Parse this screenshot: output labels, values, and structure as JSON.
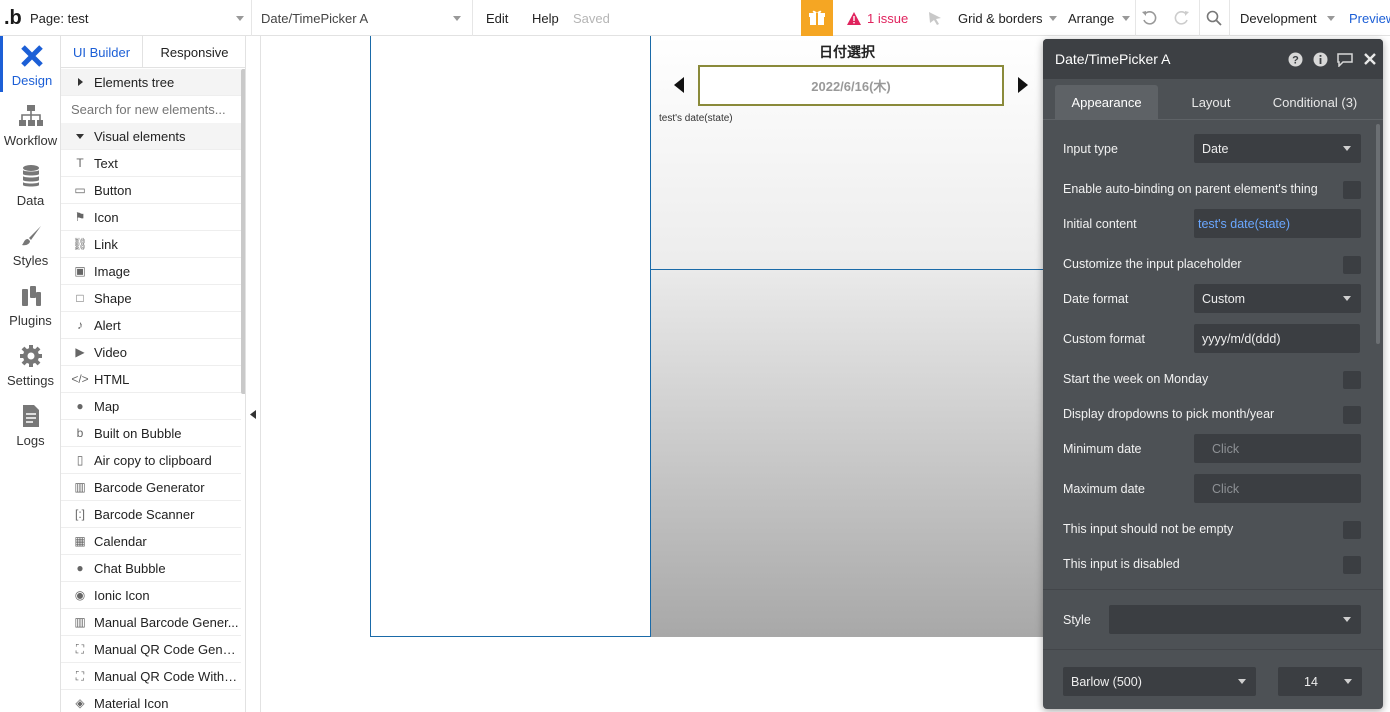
{
  "topbar": {
    "logo": ".b",
    "page_selector": "Page: test",
    "element_selector": "Date/TimePicker A",
    "edit": "Edit",
    "help": "Help",
    "saved": "Saved",
    "issues": "1 issue",
    "grid": "Grid & borders",
    "arrange": "Arrange",
    "environment": "Development",
    "preview": "Preview"
  },
  "rail": [
    {
      "label": "Design",
      "icon": "design-icon"
    },
    {
      "label": "Workflow",
      "icon": "workflow-icon"
    },
    {
      "label": "Data",
      "icon": "data-icon"
    },
    {
      "label": "Styles",
      "icon": "styles-icon"
    },
    {
      "label": "Plugins",
      "icon": "plugins-icon"
    },
    {
      "label": "Settings",
      "icon": "settings-icon"
    },
    {
      "label": "Logs",
      "icon": "logs-icon"
    }
  ],
  "panel": {
    "tab_ui_builder": "UI Builder",
    "tab_responsive": "Responsive",
    "elements_tree": "Elements tree",
    "search_placeholder": "Search for new elements...",
    "visual_elements": "Visual elements",
    "items": [
      {
        "label": "Text",
        "icon": "text-icon"
      },
      {
        "label": "Button",
        "icon": "button-icon"
      },
      {
        "label": "Icon",
        "icon": "flag-icon"
      },
      {
        "label": "Link",
        "icon": "link-icon"
      },
      {
        "label": "Image",
        "icon": "image-icon"
      },
      {
        "label": "Shape",
        "icon": "shape-icon"
      },
      {
        "label": "Alert",
        "icon": "bell-icon"
      },
      {
        "label": "Video",
        "icon": "video-icon"
      },
      {
        "label": "HTML",
        "icon": "code-icon"
      },
      {
        "label": "Map",
        "icon": "map-pin-icon"
      },
      {
        "label": "Built on Bubble",
        "icon": "bubble-icon"
      },
      {
        "label": "Air copy to clipboard",
        "icon": "clipboard-icon"
      },
      {
        "label": "Barcode Generator",
        "icon": "barcode-icon"
      },
      {
        "label": "Barcode Scanner",
        "icon": "scanner-icon"
      },
      {
        "label": "Calendar",
        "icon": "calendar-icon"
      },
      {
        "label": "Chat Bubble",
        "icon": "chat-bubble-icon"
      },
      {
        "label": "Ionic Icon",
        "icon": "ionic-icon"
      },
      {
        "label": "Manual Barcode Gener...",
        "icon": "barcode-icon"
      },
      {
        "label": "Manual QR Code Gener...",
        "icon": "qr-icon"
      },
      {
        "label": "Manual QR Code With L...",
        "icon": "qr-icon"
      },
      {
        "label": "Material Icon",
        "icon": "material-icon"
      }
    ]
  },
  "canvas": {
    "heading": "日付選択",
    "date_value": "2022/6/16(木)",
    "caption": "test's date(state)"
  },
  "prop": {
    "title": "Date/TimePicker A",
    "tabs": [
      "Appearance",
      "Layout",
      "Conditional (3)"
    ],
    "input_type_label": "Input type",
    "input_type_value": "Date",
    "auto_binding": "Enable auto-binding on parent element's thing",
    "initial_content_label": "Initial content",
    "initial_content_value": "test's date(state)",
    "customize_placeholder": "Customize the input placeholder",
    "date_format_label": "Date format",
    "date_format_value": "Custom",
    "custom_format_label": "Custom format",
    "custom_format_value": "yyyy/m/d(ddd)",
    "week_monday": "Start the week on Monday",
    "dropdowns": "Display dropdowns to pick month/year",
    "min_date_label": "Minimum date",
    "min_date_value": "Click",
    "max_date_label": "Maximum date",
    "max_date_value": "Click",
    "not_empty": "This input should not be empty",
    "disabled": "This input is disabled",
    "style_label": "Style",
    "font_value": "Barlow (500)",
    "font_size": "14"
  },
  "colors": {
    "accent_blue": "#1c5fd6",
    "issue_red": "#e0245e",
    "gift_orange": "#f5a623",
    "panel_bg": "#4d5155",
    "link_blue": "#6aa7ff"
  }
}
